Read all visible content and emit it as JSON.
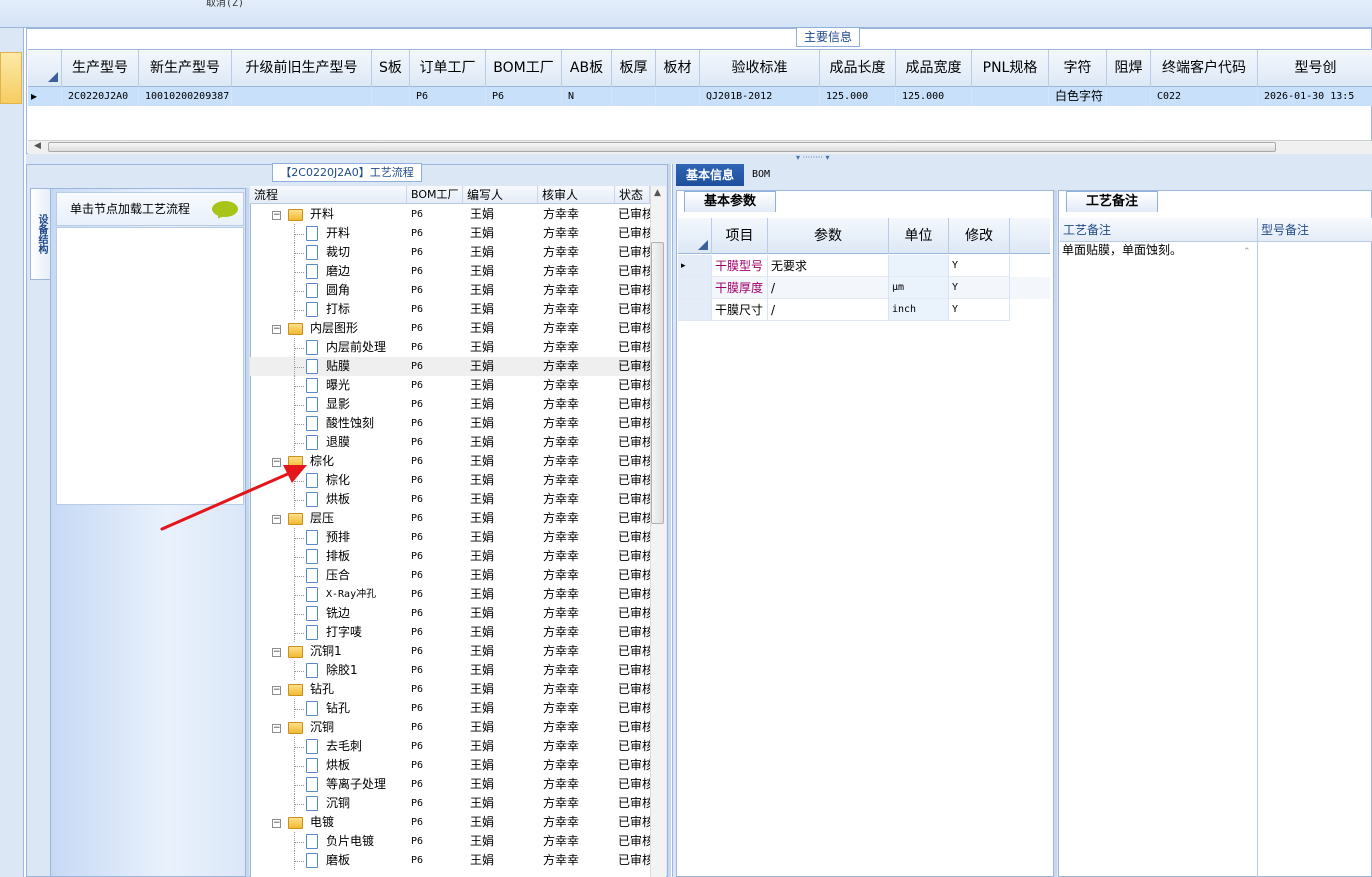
{
  "toolbar": {
    "cancel_label": "取消(Z)"
  },
  "main_info": {
    "title": "主要信息",
    "columns": [
      "生产型号",
      "新生产型号",
      "升级前旧生产型号",
      "S板",
      "订单工厂",
      "BOM工厂",
      "AB板",
      "板厚",
      "板材",
      "验收标准",
      "成品长度",
      "成品宽度",
      "PNL规格",
      "字符",
      "阻焊",
      "终端客户代码",
      "型号创"
    ],
    "row": [
      "2C0220J2A0",
      "10010200209387",
      "",
      "",
      "P6",
      "P6",
      "N",
      "",
      "",
      "QJ201B-2012",
      "125.000",
      "125.000",
      "",
      "白色字符",
      "",
      "C022",
      "2026-01-30 13:5"
    ]
  },
  "flow_panel": {
    "title": "【2C0220J2A0】工艺流程",
    "side_tab": "设备结构",
    "nav_hint": "单击节点加载工艺流程"
  },
  "tree": {
    "columns": [
      "流程",
      "BOM工厂",
      "编写人",
      "核审人",
      "状态"
    ],
    "rows": [
      {
        "name": "开料",
        "level": 0,
        "factory": "P6",
        "writer": "王娟",
        "reviewer": "方幸幸",
        "status": "已审核"
      },
      {
        "name": "开料",
        "level": 1,
        "factory": "P6",
        "writer": "王娟",
        "reviewer": "方幸幸",
        "status": "已审核"
      },
      {
        "name": "裁切",
        "level": 1,
        "factory": "P6",
        "writer": "王娟",
        "reviewer": "方幸幸",
        "status": "已审核"
      },
      {
        "name": "磨边",
        "level": 1,
        "factory": "P6",
        "writer": "王娟",
        "reviewer": "方幸幸",
        "status": "已审核"
      },
      {
        "name": "圆角",
        "level": 1,
        "factory": "P6",
        "writer": "王娟",
        "reviewer": "方幸幸",
        "status": "已审核"
      },
      {
        "name": "打标",
        "level": 1,
        "factory": "P6",
        "writer": "王娟",
        "reviewer": "方幸幸",
        "status": "已审核"
      },
      {
        "name": "内层图形",
        "level": 0,
        "factory": "P6",
        "writer": "王娟",
        "reviewer": "方幸幸",
        "status": "已审核"
      },
      {
        "name": "内层前处理",
        "level": 1,
        "factory": "P6",
        "writer": "王娟",
        "reviewer": "方幸幸",
        "status": "已审核"
      },
      {
        "name": "贴膜",
        "level": 1,
        "factory": "P6",
        "writer": "王娟",
        "reviewer": "方幸幸",
        "status": "已审核",
        "selected": true
      },
      {
        "name": "曝光",
        "level": 1,
        "factory": "P6",
        "writer": "王娟",
        "reviewer": "方幸幸",
        "status": "已审核"
      },
      {
        "name": "显影",
        "level": 1,
        "factory": "P6",
        "writer": "王娟",
        "reviewer": "方幸幸",
        "status": "已审核"
      },
      {
        "name": "酸性蚀刻",
        "level": 1,
        "factory": "P6",
        "writer": "王娟",
        "reviewer": "方幸幸",
        "status": "已审核"
      },
      {
        "name": "退膜",
        "level": 1,
        "factory": "P6",
        "writer": "王娟",
        "reviewer": "方幸幸",
        "status": "已审核"
      },
      {
        "name": "棕化",
        "level": 0,
        "factory": "P6",
        "writer": "王娟",
        "reviewer": "方幸幸",
        "status": "已审核"
      },
      {
        "name": "棕化",
        "level": 1,
        "factory": "P6",
        "writer": "王娟",
        "reviewer": "方幸幸",
        "status": "已审核"
      },
      {
        "name": "烘板",
        "level": 1,
        "factory": "P6",
        "writer": "王娟",
        "reviewer": "方幸幸",
        "status": "已审核"
      },
      {
        "name": "层压",
        "level": 0,
        "factory": "P6",
        "writer": "王娟",
        "reviewer": "方幸幸",
        "status": "已审核"
      },
      {
        "name": "预排",
        "level": 1,
        "factory": "P6",
        "writer": "王娟",
        "reviewer": "方幸幸",
        "status": "已审核"
      },
      {
        "name": "排板",
        "level": 1,
        "factory": "P6",
        "writer": "王娟",
        "reviewer": "方幸幸",
        "status": "已审核"
      },
      {
        "name": "压合",
        "level": 1,
        "factory": "P6",
        "writer": "王娟",
        "reviewer": "方幸幸",
        "status": "已审核"
      },
      {
        "name": "X-Ray冲孔",
        "level": 1,
        "factory": "P6",
        "writer": "王娟",
        "reviewer": "方幸幸",
        "status": "已审核"
      },
      {
        "name": "铣边",
        "level": 1,
        "factory": "P6",
        "writer": "王娟",
        "reviewer": "方幸幸",
        "status": "已审核"
      },
      {
        "name": "打字唛",
        "level": 1,
        "factory": "P6",
        "writer": "王娟",
        "reviewer": "方幸幸",
        "status": "已审核"
      },
      {
        "name": "沉铜1",
        "level": 0,
        "factory": "P6",
        "writer": "王娟",
        "reviewer": "方幸幸",
        "status": "已审核"
      },
      {
        "name": "除胶1",
        "level": 1,
        "factory": "P6",
        "writer": "王娟",
        "reviewer": "方幸幸",
        "status": "已审核"
      },
      {
        "name": "钻孔",
        "level": 0,
        "factory": "P6",
        "writer": "王娟",
        "reviewer": "方幸幸",
        "status": "已审核"
      },
      {
        "name": "钻孔",
        "level": 1,
        "factory": "P6",
        "writer": "王娟",
        "reviewer": "方幸幸",
        "status": "已审核"
      },
      {
        "name": "沉铜",
        "level": 0,
        "factory": "P6",
        "writer": "王娟",
        "reviewer": "方幸幸",
        "status": "已审核"
      },
      {
        "name": "去毛刺",
        "level": 1,
        "factory": "P6",
        "writer": "王娟",
        "reviewer": "方幸幸",
        "status": "已审核"
      },
      {
        "name": "烘板",
        "level": 1,
        "factory": "P6",
        "writer": "王娟",
        "reviewer": "方幸幸",
        "status": "已审核"
      },
      {
        "name": "等离子处理",
        "level": 1,
        "factory": "P6",
        "writer": "王娟",
        "reviewer": "方幸幸",
        "status": "已审核"
      },
      {
        "name": "沉铜",
        "level": 1,
        "factory": "P6",
        "writer": "王娟",
        "reviewer": "方幸幸",
        "status": "已审核"
      },
      {
        "name": "电镀",
        "level": 0,
        "factory": "P6",
        "writer": "王娟",
        "reviewer": "方幸幸",
        "status": "已审核"
      },
      {
        "name": "负片电镀",
        "level": 1,
        "factory": "P6",
        "writer": "王娟",
        "reviewer": "方幸幸",
        "status": "已审核"
      },
      {
        "name": "磨板",
        "level": 1,
        "factory": "P6",
        "writer": "王娟",
        "reviewer": "方幸幸",
        "status": "已审核"
      }
    ]
  },
  "right_tabs": {
    "basic": "基本信息",
    "bom": "BOM"
  },
  "params": {
    "tab": "基本参数",
    "columns": [
      "项目",
      "参数",
      "单位",
      "修改"
    ],
    "rows": [
      {
        "item": "干膜型号",
        "value": "无要求",
        "unit": "",
        "modify": "Y"
      },
      {
        "item": "干膜厚度",
        "value": "/",
        "unit": "μm",
        "modify": "Y"
      },
      {
        "item": "干膜尺寸",
        "value": "/",
        "unit": "inch",
        "modify": "Y"
      }
    ]
  },
  "notes": {
    "tab": "工艺备注",
    "columns": [
      "工艺备注",
      "型号备注"
    ],
    "process_note": "单面贴膜，单面蚀刻。"
  },
  "colors": {
    "accent": "#1e4f9c",
    "selected_row": "#c9e0fa",
    "arrow": "#e3161b",
    "highlight_text": "#a0006b"
  }
}
